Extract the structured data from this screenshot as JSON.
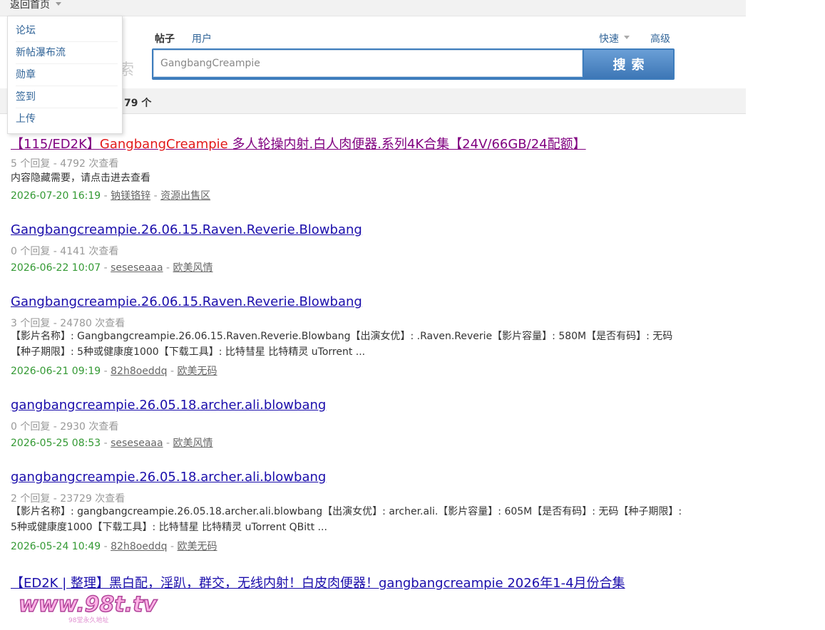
{
  "topbar": {
    "home_label": "返回首页"
  },
  "dropdown": {
    "items": [
      {
        "label": "论坛"
      },
      {
        "label": "新帖瀑布流"
      },
      {
        "label": "勋章"
      },
      {
        "label": "签到"
      },
      {
        "label": "上传"
      }
    ]
  },
  "search": {
    "ghost_label": "索",
    "tabs": [
      {
        "label": "帖子"
      },
      {
        "label": "用户"
      }
    ],
    "quick_label": "快速",
    "advanced_label": "高级",
    "query": "GangbangCreampie",
    "button_label": "搜索"
  },
  "summary": {
    "text": "gCreampie” 相关内容 79 个"
  },
  "results": [
    {
      "title_pre": "【115/ED2K】",
      "title_hl": "GangbangCreampie",
      "title_post": " 多人轮操内射.白人肉便器.系列4K合集【24V/66GB/24配额】",
      "stats": "5 个回复 - 4792 次查看",
      "desc": "内容隐藏需要，请点击进去查看",
      "date": "2026-07-20 16:19",
      "author": "钠镁铬锌",
      "forum": "资源出售区"
    },
    {
      "title": "Gangbangcreampie.26.06.15.Raven.Reverie.Blowbang",
      "stats": "0 个回复 - 4141 次查看",
      "date": "2026-06-22 10:07",
      "author": "seseseaaa",
      "forum": "欧美风情"
    },
    {
      "title": "Gangbangcreampie.26.06.15.Raven.Reverie.Blowbang",
      "stats": "3 个回复 - 24780 次查看",
      "desc": "【影片名称】: Gangbangcreampie.26.06.15.Raven.Reverie.Blowbang【出演女优】: .Raven.Reverie【影片容量】: 580M【是否有码】: 无码【种子期限】: 5种或健康度1000【下载工具】: 比特彗星 比特精灵 uTorrent ...",
      "date": "2026-06-21 09:19",
      "author": "82h8oeddq",
      "forum": "欧美无码"
    },
    {
      "title": "gangbangcreampie.26.05.18.archer.ali.blowbang",
      "stats": "0 个回复 - 2930 次查看",
      "date": "2026-05-25 08:53",
      "author": "seseseaaa",
      "forum": "欧美风情"
    },
    {
      "title": "gangbangcreampie.26.05.18.archer.ali.blowbang",
      "stats": "2 个回复 - 23729 次查看",
      "desc": "【影片名称】: gangbangcreampie.26.05.18.archer.ali.blowbang【出演女优】: archer.ali.【影片容量】: 605M【是否有码】: 无码【种子期限】: 5种或健康度1000【下载工具】: 比特彗星 比特精灵 uTorrent QBitt ...",
      "date": "2026-05-24 10:49",
      "author": "82h8oeddq",
      "forum": "欧美无码"
    },
    {
      "title": "【ED2K | 整理】黑白配，淫趴，群交，无线内射！白皮肉便器！gangbangcreampie 2026年1-4月份合集"
    }
  ],
  "footer_sep": " - ",
  "watermark": {
    "text": "www.98t.tv",
    "subtext": "98堂永久地址"
  },
  "colors": {
    "link": "#1a0dab",
    "visited": "#800080",
    "highlight": "#e21a1a",
    "date_green": "#339933",
    "meta_gray": "#999999",
    "accent_blue": "#3e7dbd"
  }
}
